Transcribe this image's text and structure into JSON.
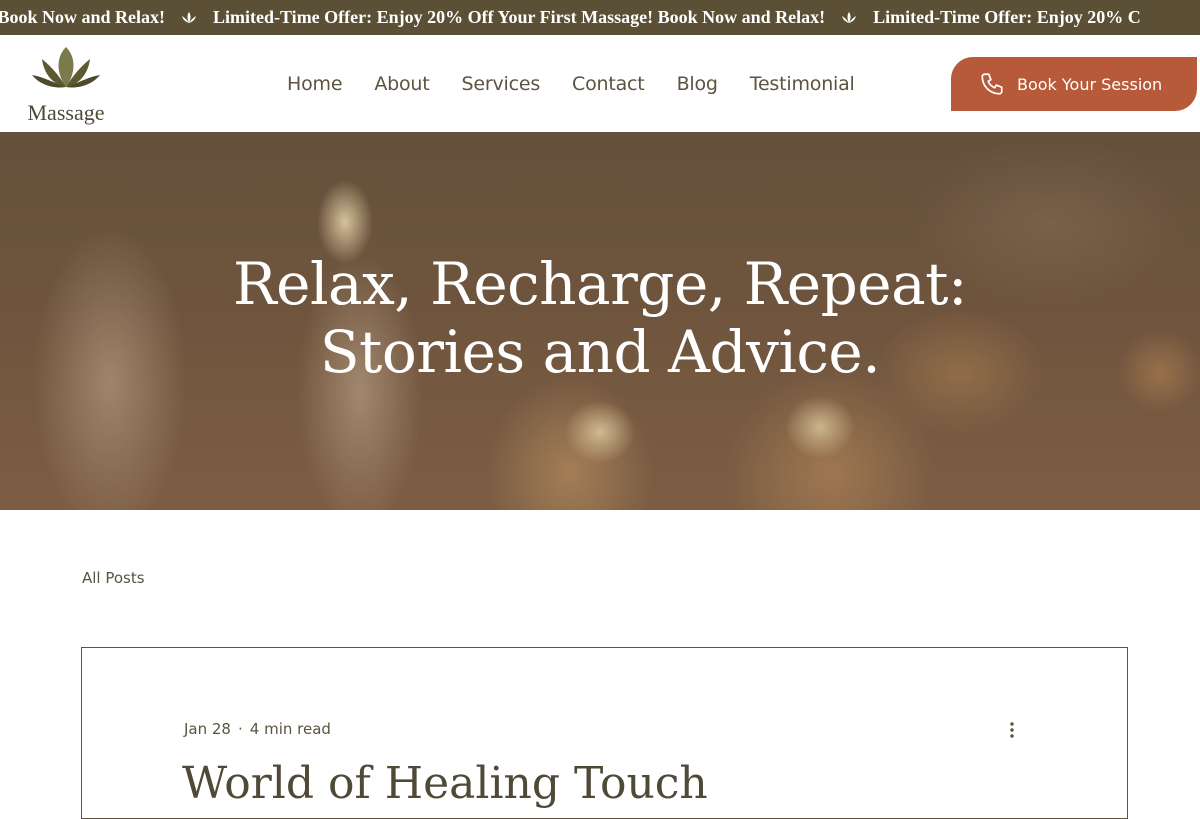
{
  "banner": {
    "segments": [
      "sage! Book Now and Relax!",
      "Limited-Time Offer: Enjoy 20% Off Your First Massage! Book Now and Relax!",
      "Limited-Time Offer: Enjoy 20% C"
    ],
    "separator_icon": "lotus-icon",
    "background": "#5b5035"
  },
  "header": {
    "logo_text": "Massage",
    "logo_icon": "lotus-icon",
    "nav": [
      "Home",
      "About",
      "Services",
      "Contact",
      "Blog",
      "Testimonial"
    ],
    "cta": {
      "label": "Book Your Session",
      "icon": "phone-icon",
      "color": "#b75a3a"
    }
  },
  "hero": {
    "title_line1": "Relax, Recharge, Repeat:",
    "title_line2": "Stories and Advice."
  },
  "blog": {
    "filter_label": "All Posts",
    "posts": [
      {
        "date": "Jan 28",
        "read_time": "4 min read",
        "title": "World of Healing Touch",
        "menu_icon": "more-vertical-icon"
      }
    ]
  }
}
